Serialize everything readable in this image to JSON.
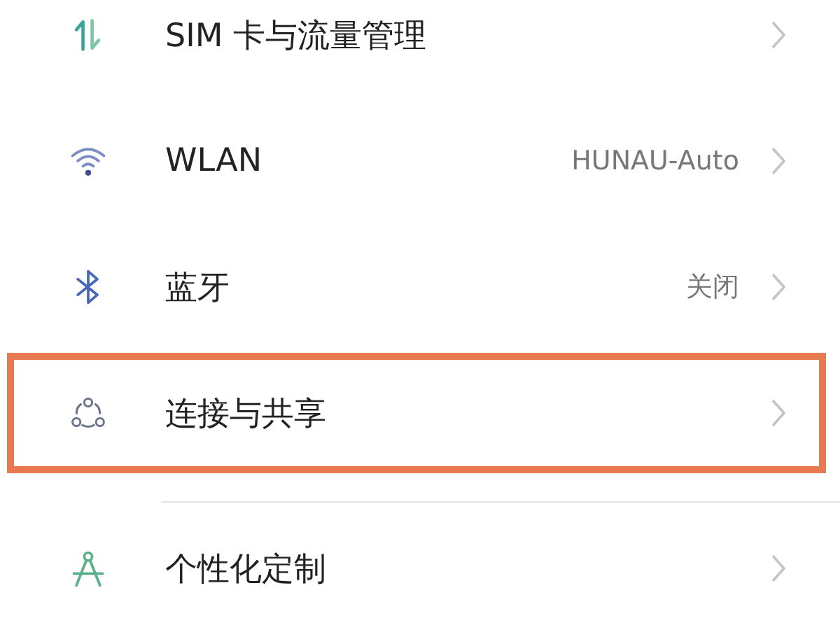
{
  "settings": [
    {
      "kind": "sim",
      "label": "SIM 卡与流量管理",
      "highlighted": false
    },
    {
      "kind": "wifi",
      "label": "WLAN",
      "value": "HUNAU-Auto",
      "highlighted": false
    },
    {
      "kind": "bluetooth",
      "label": "蓝牙",
      "value": "关闭",
      "highlighted": false
    },
    {
      "kind": "share",
      "label": "连接与共享",
      "highlighted": true
    },
    {
      "kind": "theme",
      "label": "个性化定制",
      "highlighted": false
    }
  ]
}
